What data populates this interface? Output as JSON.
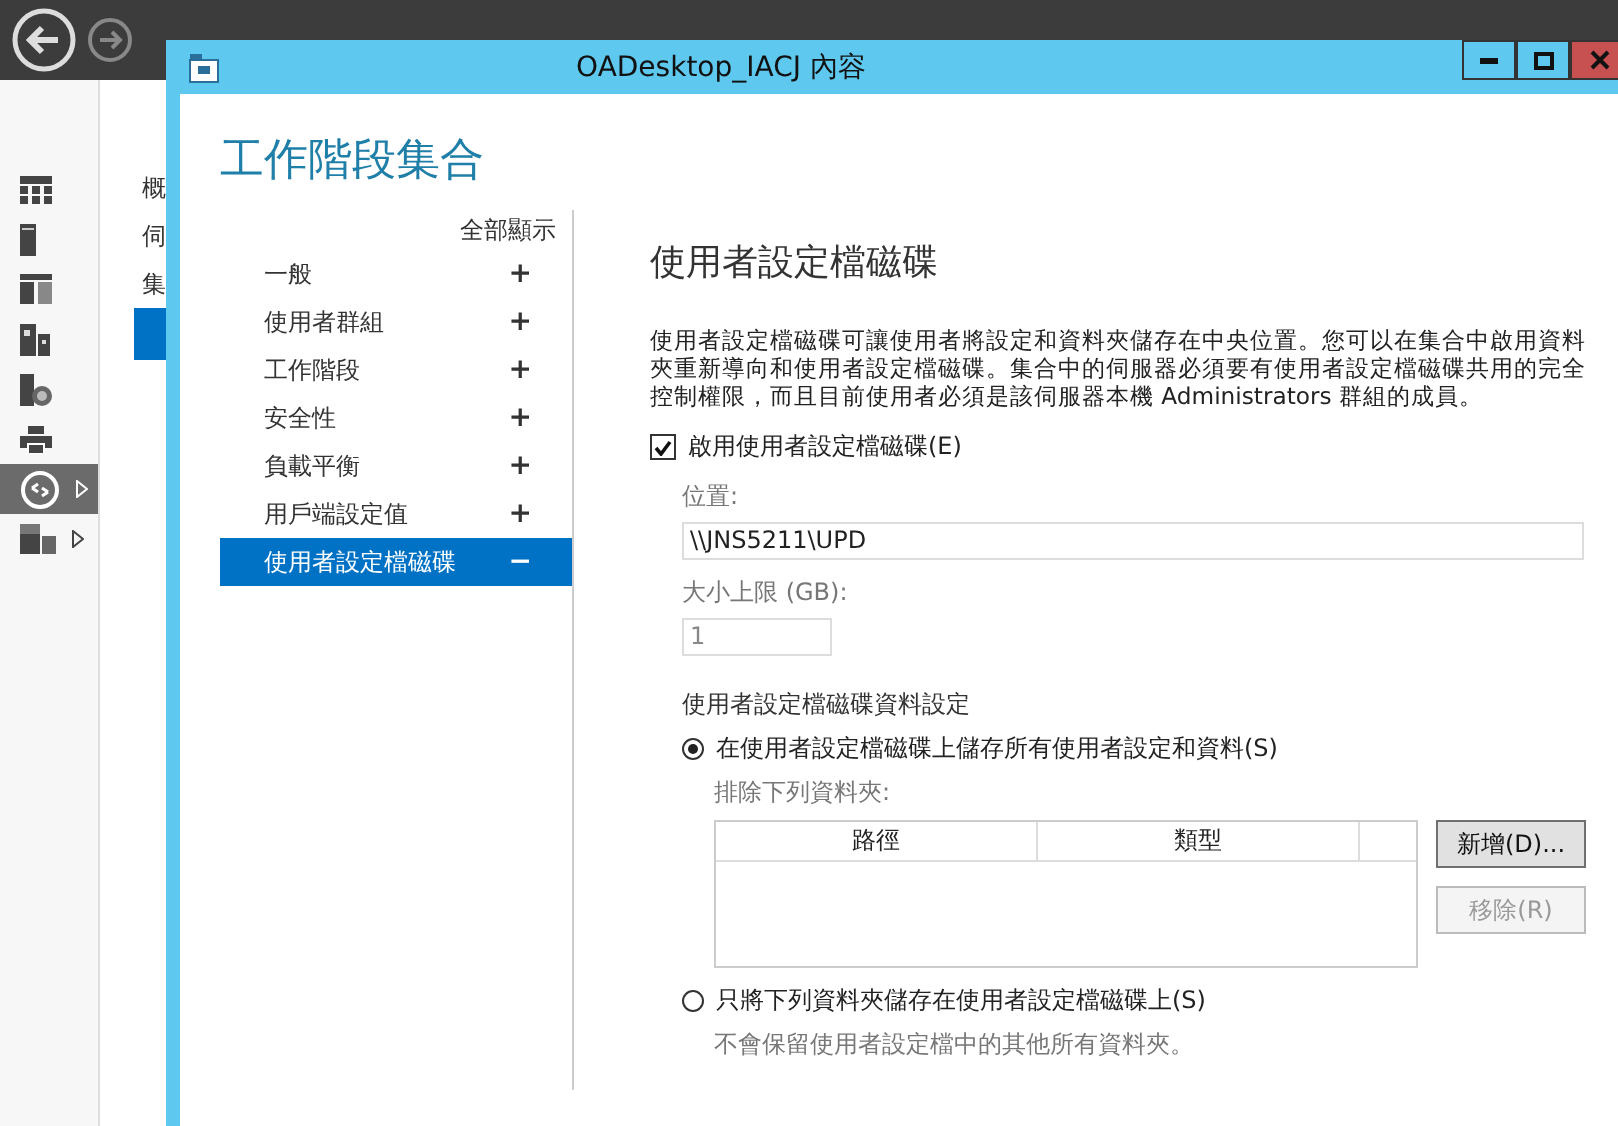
{
  "background_app": {
    "rail": [
      {
        "kind": "grid",
        "selected": false,
        "has_children": false
      },
      {
        "kind": "tower",
        "selected": false,
        "has_children": false
      },
      {
        "kind": "panels",
        "selected": false,
        "has_children": false
      },
      {
        "kind": "building",
        "selected": false,
        "has_children": false
      },
      {
        "kind": "server-globe",
        "selected": false,
        "has_children": false
      },
      {
        "kind": "printer",
        "selected": false,
        "has_children": false
      },
      {
        "kind": "remote",
        "selected": true,
        "has_children": true
      },
      {
        "kind": "folders",
        "selected": false,
        "has_children": true
      }
    ],
    "nav": [
      {
        "label": "概",
        "selected": false
      },
      {
        "label": "伺",
        "selected": false
      },
      {
        "label": "集",
        "selected": false
      },
      {
        "selected": true
      }
    ]
  },
  "dialog": {
    "title": "OADesktop_IACJ 內容",
    "heading": "工作階段集合",
    "nav": {
      "show_all": "全部顯示",
      "items": [
        {
          "label": "一般",
          "toggle": "+",
          "selected": false
        },
        {
          "label": "使用者群組",
          "toggle": "+",
          "selected": false
        },
        {
          "label": "工作階段",
          "toggle": "+",
          "selected": false
        },
        {
          "label": "安全性",
          "toggle": "+",
          "selected": false
        },
        {
          "label": "負載平衡",
          "toggle": "+",
          "selected": false
        },
        {
          "label": "用戶端設定值",
          "toggle": "+",
          "selected": false
        },
        {
          "label": "使用者設定檔磁碟",
          "toggle": "−",
          "selected": true
        }
      ]
    },
    "section": {
      "title": "使用者設定檔磁碟",
      "description": "使用者設定檔磁碟可讓使用者將設定和資料夾儲存在中央位置。您可以在集合中啟用資料夾重新導向和使用者設定檔磁碟。集合中的伺服器必須要有使用者設定檔磁碟共用的完全控制權限，而且目前使用者必須是該伺服器本機 Administrators 群組的成員。",
      "enable": {
        "label": "啟用使用者設定檔磁碟(E)",
        "checked": true
      },
      "location": {
        "label": "位置:",
        "value": "\\\\JNS5211\\UPD"
      },
      "size_limit": {
        "label": "大小上限 (GB):",
        "value": "1",
        "disabled": true
      },
      "data_settings": {
        "label": "使用者設定檔磁碟資料設定",
        "store_all": {
          "label": "在使用者設定檔磁碟上儲存所有使用者設定和資料(S)",
          "selected": true
        },
        "exclude_label": "排除下列資料夾:",
        "table": {
          "columns": [
            "路徑",
            "類型"
          ]
        },
        "buttons": [
          {
            "label": "新增(D)...",
            "disabled": false
          },
          {
            "label": "移除(R)",
            "disabled": true
          }
        ],
        "store_listed": {
          "label": "只將下列資料夾儲存在使用者設定檔磁碟上(S)",
          "selected": false
        },
        "note": "不會保留使用者設定檔中的其他所有資料夾。"
      }
    }
  }
}
